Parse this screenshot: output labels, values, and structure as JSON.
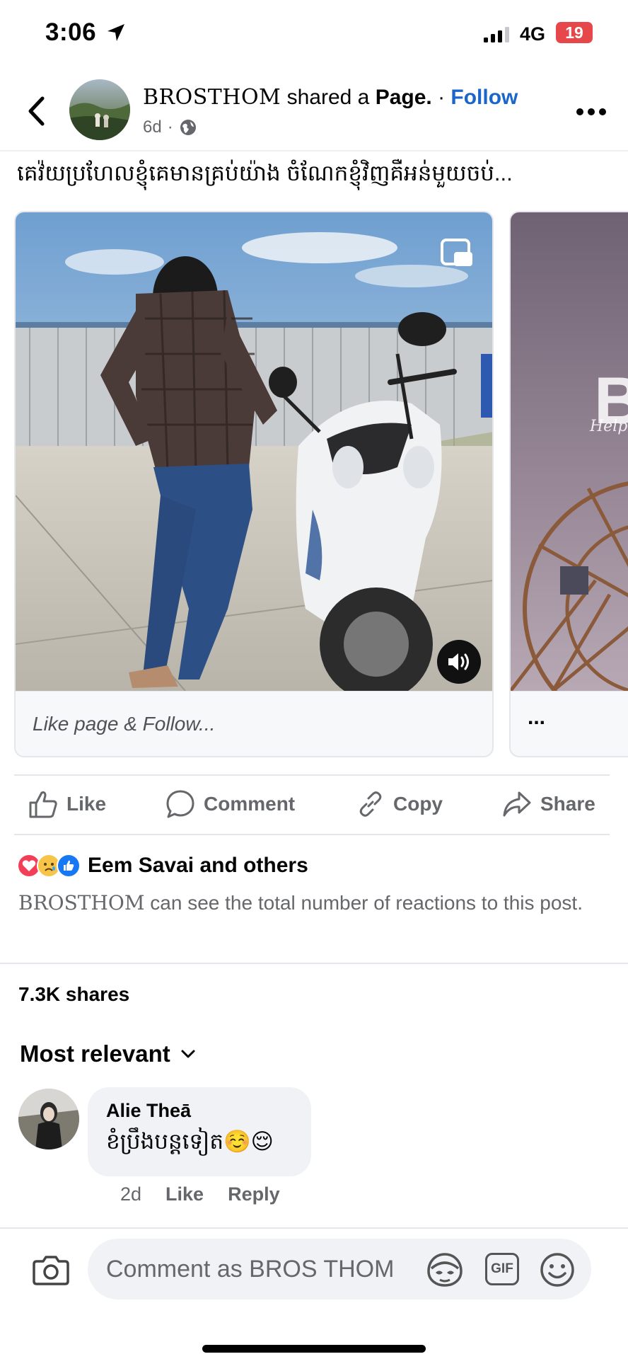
{
  "status_bar": {
    "time": "3:06",
    "network": "4G",
    "battery": "19"
  },
  "header": {
    "page_name": "BROSTHOM",
    "shared_text": " shared a ",
    "object_text": "Page.",
    "separator": " · ",
    "follow_label": "Follow",
    "time": "6d",
    "dot": "·",
    "privacy_icon": "globe-icon"
  },
  "post": {
    "caption": "គេវ៉យប្រហែលខ្ញុំគេមានគ្រប់យ៉ាង ចំណែកខ្ញុំវិញគឺអន់មួយចប់...",
    "cards": [
      {
        "footer_text": "Like page & Follow..."
      },
      {
        "footer_text": "...",
        "peek_letter": "B",
        "peek_sub": "Help L"
      }
    ]
  },
  "actions": [
    {
      "label": "Like",
      "icon": "thumbs-up-icon"
    },
    {
      "label": "Comment",
      "icon": "comment-bubble-icon"
    },
    {
      "label": "Copy",
      "icon": "link-icon"
    },
    {
      "label": "Share",
      "icon": "share-arrow-icon"
    }
  ],
  "reactions": {
    "summary": "Eem Savai and others",
    "icons": [
      "love-reaction-icon",
      "sad-reaction-icon",
      "like-reaction-icon"
    ],
    "note_page": "BROSTHOM",
    "note_rest": " can see the total number of reactions to this post."
  },
  "shares": "7.3K shares",
  "sort": {
    "label": "Most relevant"
  },
  "comment": {
    "author": "Alie Theā",
    "text": "ខំប្រឹងបន្តទៀត☺️😌",
    "time": "2d",
    "like_label": "Like",
    "reply_label": "Reply"
  },
  "composer": {
    "placeholder": "Comment as BROS THOM",
    "gif_label": "GIF"
  },
  "colors": {
    "accent_blue": "#1b66c9",
    "secondary_text": "#65676b",
    "battery_red": "#e5474a",
    "bubble_bg": "#f0f2f5"
  }
}
